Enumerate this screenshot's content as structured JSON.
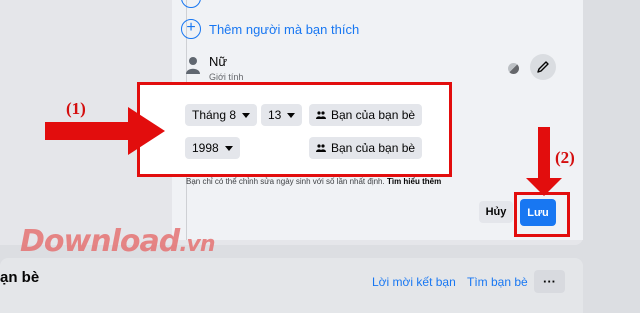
{
  "add_person": {
    "label": "Thêm người mà bạn thích",
    "icon": "plus-circle-icon"
  },
  "gender": {
    "value": "Nữ",
    "caption": "Giới tính",
    "icon": "person-icon"
  },
  "birthday": {
    "month": "Tháng 8",
    "day": "13",
    "year": "1998",
    "audience_label": "Bạn của bạn bè",
    "audience_icon": "friends-icon"
  },
  "note": {
    "text": "Bạn chỉ có thể chỉnh sửa ngày sinh với số lần nhất định.",
    "link": "Tìm hiểu thêm"
  },
  "actions": {
    "cancel": "Hủy",
    "save": "Lưu"
  },
  "annotations": {
    "step1": "(1)",
    "step2": "(2)",
    "color": "#e20d0d"
  },
  "watermark": {
    "main": "Download",
    "suffix": ".vn"
  },
  "friends_section": {
    "title": "ạn bè",
    "requests_link": "Lời mời kết bạn",
    "find_link": "Tìm bạn bè",
    "more": "···"
  },
  "colors": {
    "accent": "#1877f2",
    "annotation_red": "#e20d0d"
  }
}
